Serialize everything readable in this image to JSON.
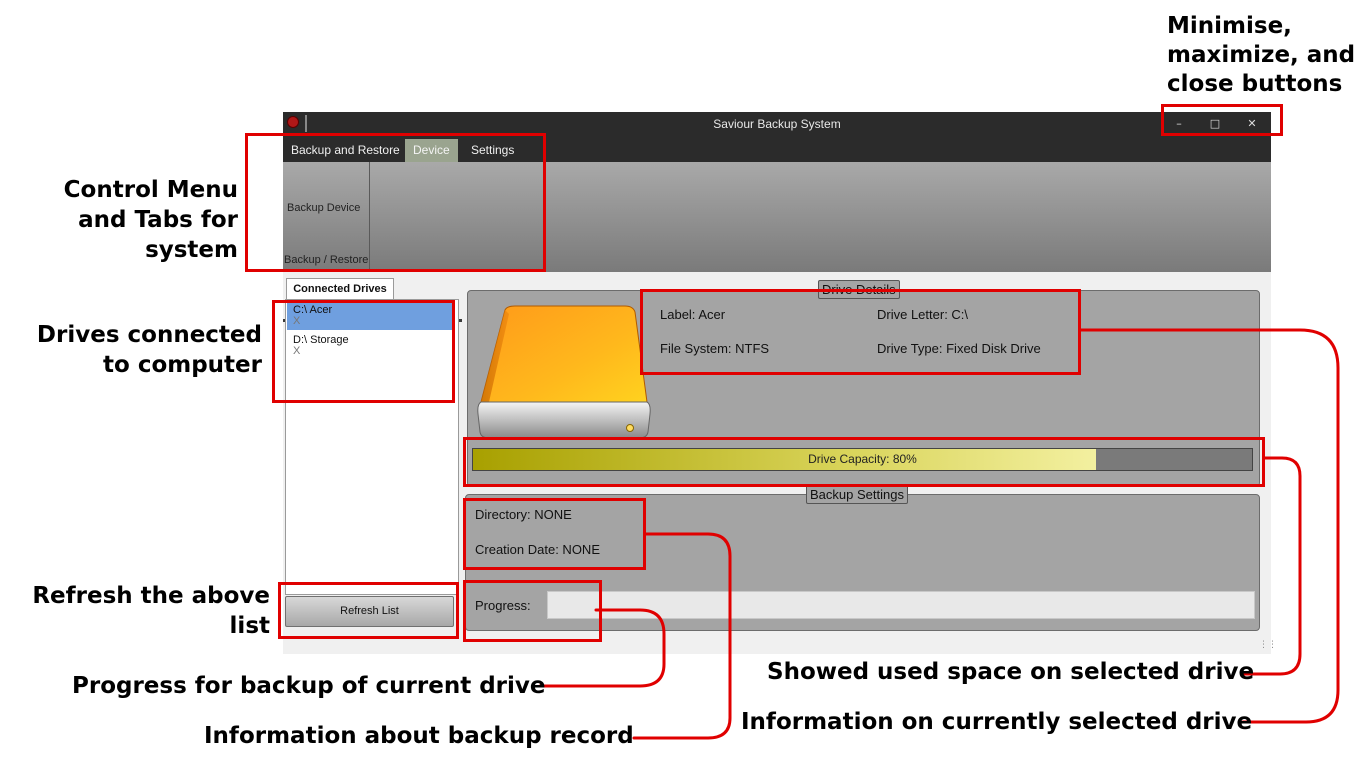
{
  "window": {
    "title": "Saviour Backup System",
    "controls": {
      "minimize": "–",
      "maximize": "□",
      "close": "✕"
    }
  },
  "menu": {
    "tabs": [
      {
        "label": "Backup and Restore",
        "active": false
      },
      {
        "label": "Device",
        "active": true
      },
      {
        "label": "Settings",
        "active": false
      }
    ]
  },
  "ribbon": {
    "item_label": "Backup Device",
    "group_label": "Backup / Restore"
  },
  "drives_panel": {
    "tab_label": "Connected Drives",
    "drives": [
      {
        "name": "C:\\ Acer",
        "sub": "X",
        "selected": true
      },
      {
        "name": "D:\\ Storage",
        "sub": "X",
        "selected": false
      }
    ],
    "refresh_label": "Refresh List"
  },
  "drive_details": {
    "legend": "Drive Details",
    "label": "Label: Acer",
    "drive_letter": "Drive Letter: C:\\",
    "file_system": "File System: NTFS",
    "drive_type": "Drive Type: Fixed Disk Drive",
    "capacity_text": "Drive Capacity: 80%",
    "capacity_fraction": 0.8
  },
  "backup_settings": {
    "legend": "Backup Settings",
    "directory": "Directory: NONE",
    "creation_date": "Creation Date: NONE",
    "progress_label": "Progress:",
    "progress_fraction": 0
  },
  "annotations": {
    "window_controls": [
      "Minimise,",
      "maximize, and",
      "close buttons"
    ],
    "control_menu": [
      "Control Menu",
      "and Tabs for",
      "system"
    ],
    "drives_connected": [
      "Drives connected",
      "to computer"
    ],
    "refresh": [
      "Refresh the above",
      "list"
    ],
    "progress": "Progress for backup of current drive",
    "backup_info": "Information about backup record",
    "used_space": "Showed used space on selected drive",
    "drive_info": "Information on currently selected drive"
  },
  "colors": {
    "annotation_red": "#e00000",
    "selected_drive": "#6f9fdf",
    "active_tab": "#9aa48f",
    "capacity_fill": "#d9d45a"
  }
}
